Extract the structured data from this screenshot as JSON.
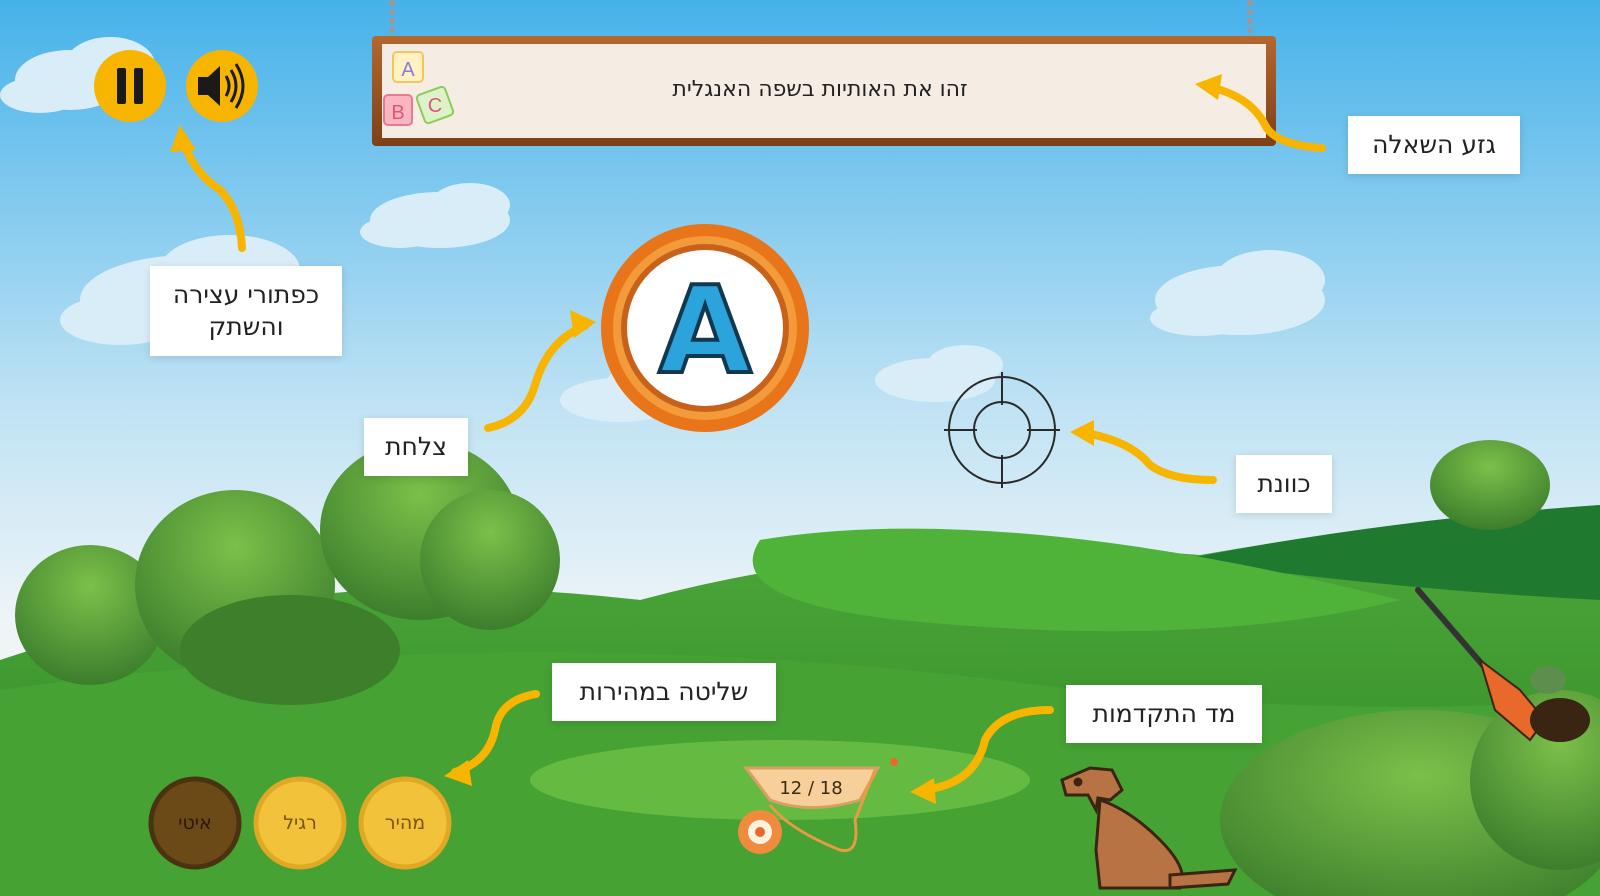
{
  "question": {
    "text": "זהו את האותיות בשפה האנגלית"
  },
  "board_blocks": [
    "A",
    "B",
    "C"
  ],
  "controls": {
    "pause_icon": "pause-icon",
    "sound_icon": "speaker-icon"
  },
  "target": {
    "letter": "A"
  },
  "progress": {
    "text": "12 / 18",
    "current": 12,
    "total": 18
  },
  "speed": {
    "slow": "איטי",
    "normal": "רגיל",
    "fast": "מהיר",
    "selected": "slow"
  },
  "callouts": {
    "question_stem": "גזע השאלה",
    "pause_sound": "כפתורי עצירה\nוהשתק",
    "target": "צלחת",
    "crosshair": "כוונת",
    "speed_control": "שליטה במהירות",
    "progress_bar": "מד התקדמות"
  },
  "colors": {
    "accent": "#F7B500",
    "sky_top": "#4FB8EC",
    "grass": "#3F9B2D",
    "target_ring": "#E8751A",
    "letter": "#2BA3DB"
  }
}
